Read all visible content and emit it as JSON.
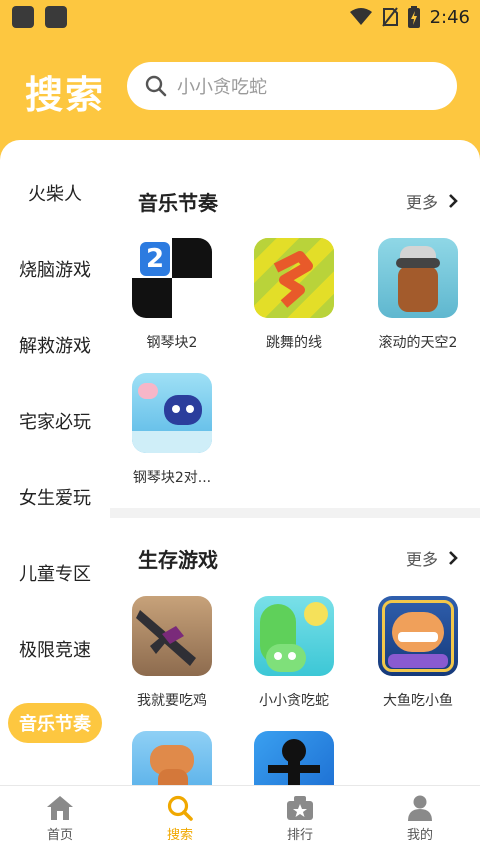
{
  "status_bar": {
    "time": "2:46"
  },
  "header": {
    "title": "搜索",
    "search_placeholder": "小小贪吃蛇"
  },
  "sidebar": {
    "items": [
      {
        "label": "火柴人",
        "active": false
      },
      {
        "label": "烧脑游戏",
        "active": false
      },
      {
        "label": "解救游戏",
        "active": false
      },
      {
        "label": "宅家必玩",
        "active": false
      },
      {
        "label": "女生爱玩",
        "active": false
      },
      {
        "label": "儿童专区",
        "active": false
      },
      {
        "label": "极限竞速",
        "active": false
      },
      {
        "label": "音乐节奏",
        "active": true
      }
    ]
  },
  "sections": [
    {
      "title": "音乐节奏",
      "more_label": "更多",
      "games": [
        {
          "name": "钢琴块2",
          "icon": "piano-tiles-icon"
        },
        {
          "name": "跳舞的线",
          "icon": "dancing-line-icon"
        },
        {
          "name": "滚动的天空2",
          "icon": "rolling-sky-icon"
        },
        {
          "name": "钢琴块2对...",
          "icon": "piano-tiles-battle-icon"
        }
      ]
    },
    {
      "title": "生存游戏",
      "more_label": "更多",
      "games": [
        {
          "name": "我就要吃鸡",
          "icon": "gun-game-icon"
        },
        {
          "name": "小小贪吃蛇",
          "icon": "snake-game-icon"
        },
        {
          "name": "大鱼吃小鱼",
          "icon": "fish-game-icon"
        },
        {
          "name": "",
          "icon": "dinosaur-game-icon"
        },
        {
          "name": "",
          "icon": "stickman-game-icon"
        }
      ]
    }
  ],
  "tabbar": {
    "tabs": [
      {
        "label": "首页",
        "icon": "home-icon",
        "active": false
      },
      {
        "label": "搜索",
        "icon": "search-icon",
        "active": true
      },
      {
        "label": "排行",
        "icon": "ranking-icon",
        "active": false
      },
      {
        "label": "我的",
        "icon": "profile-icon",
        "active": false
      }
    ]
  },
  "colors": {
    "accent": "#FDC740",
    "active_tab": "#F0A800"
  }
}
